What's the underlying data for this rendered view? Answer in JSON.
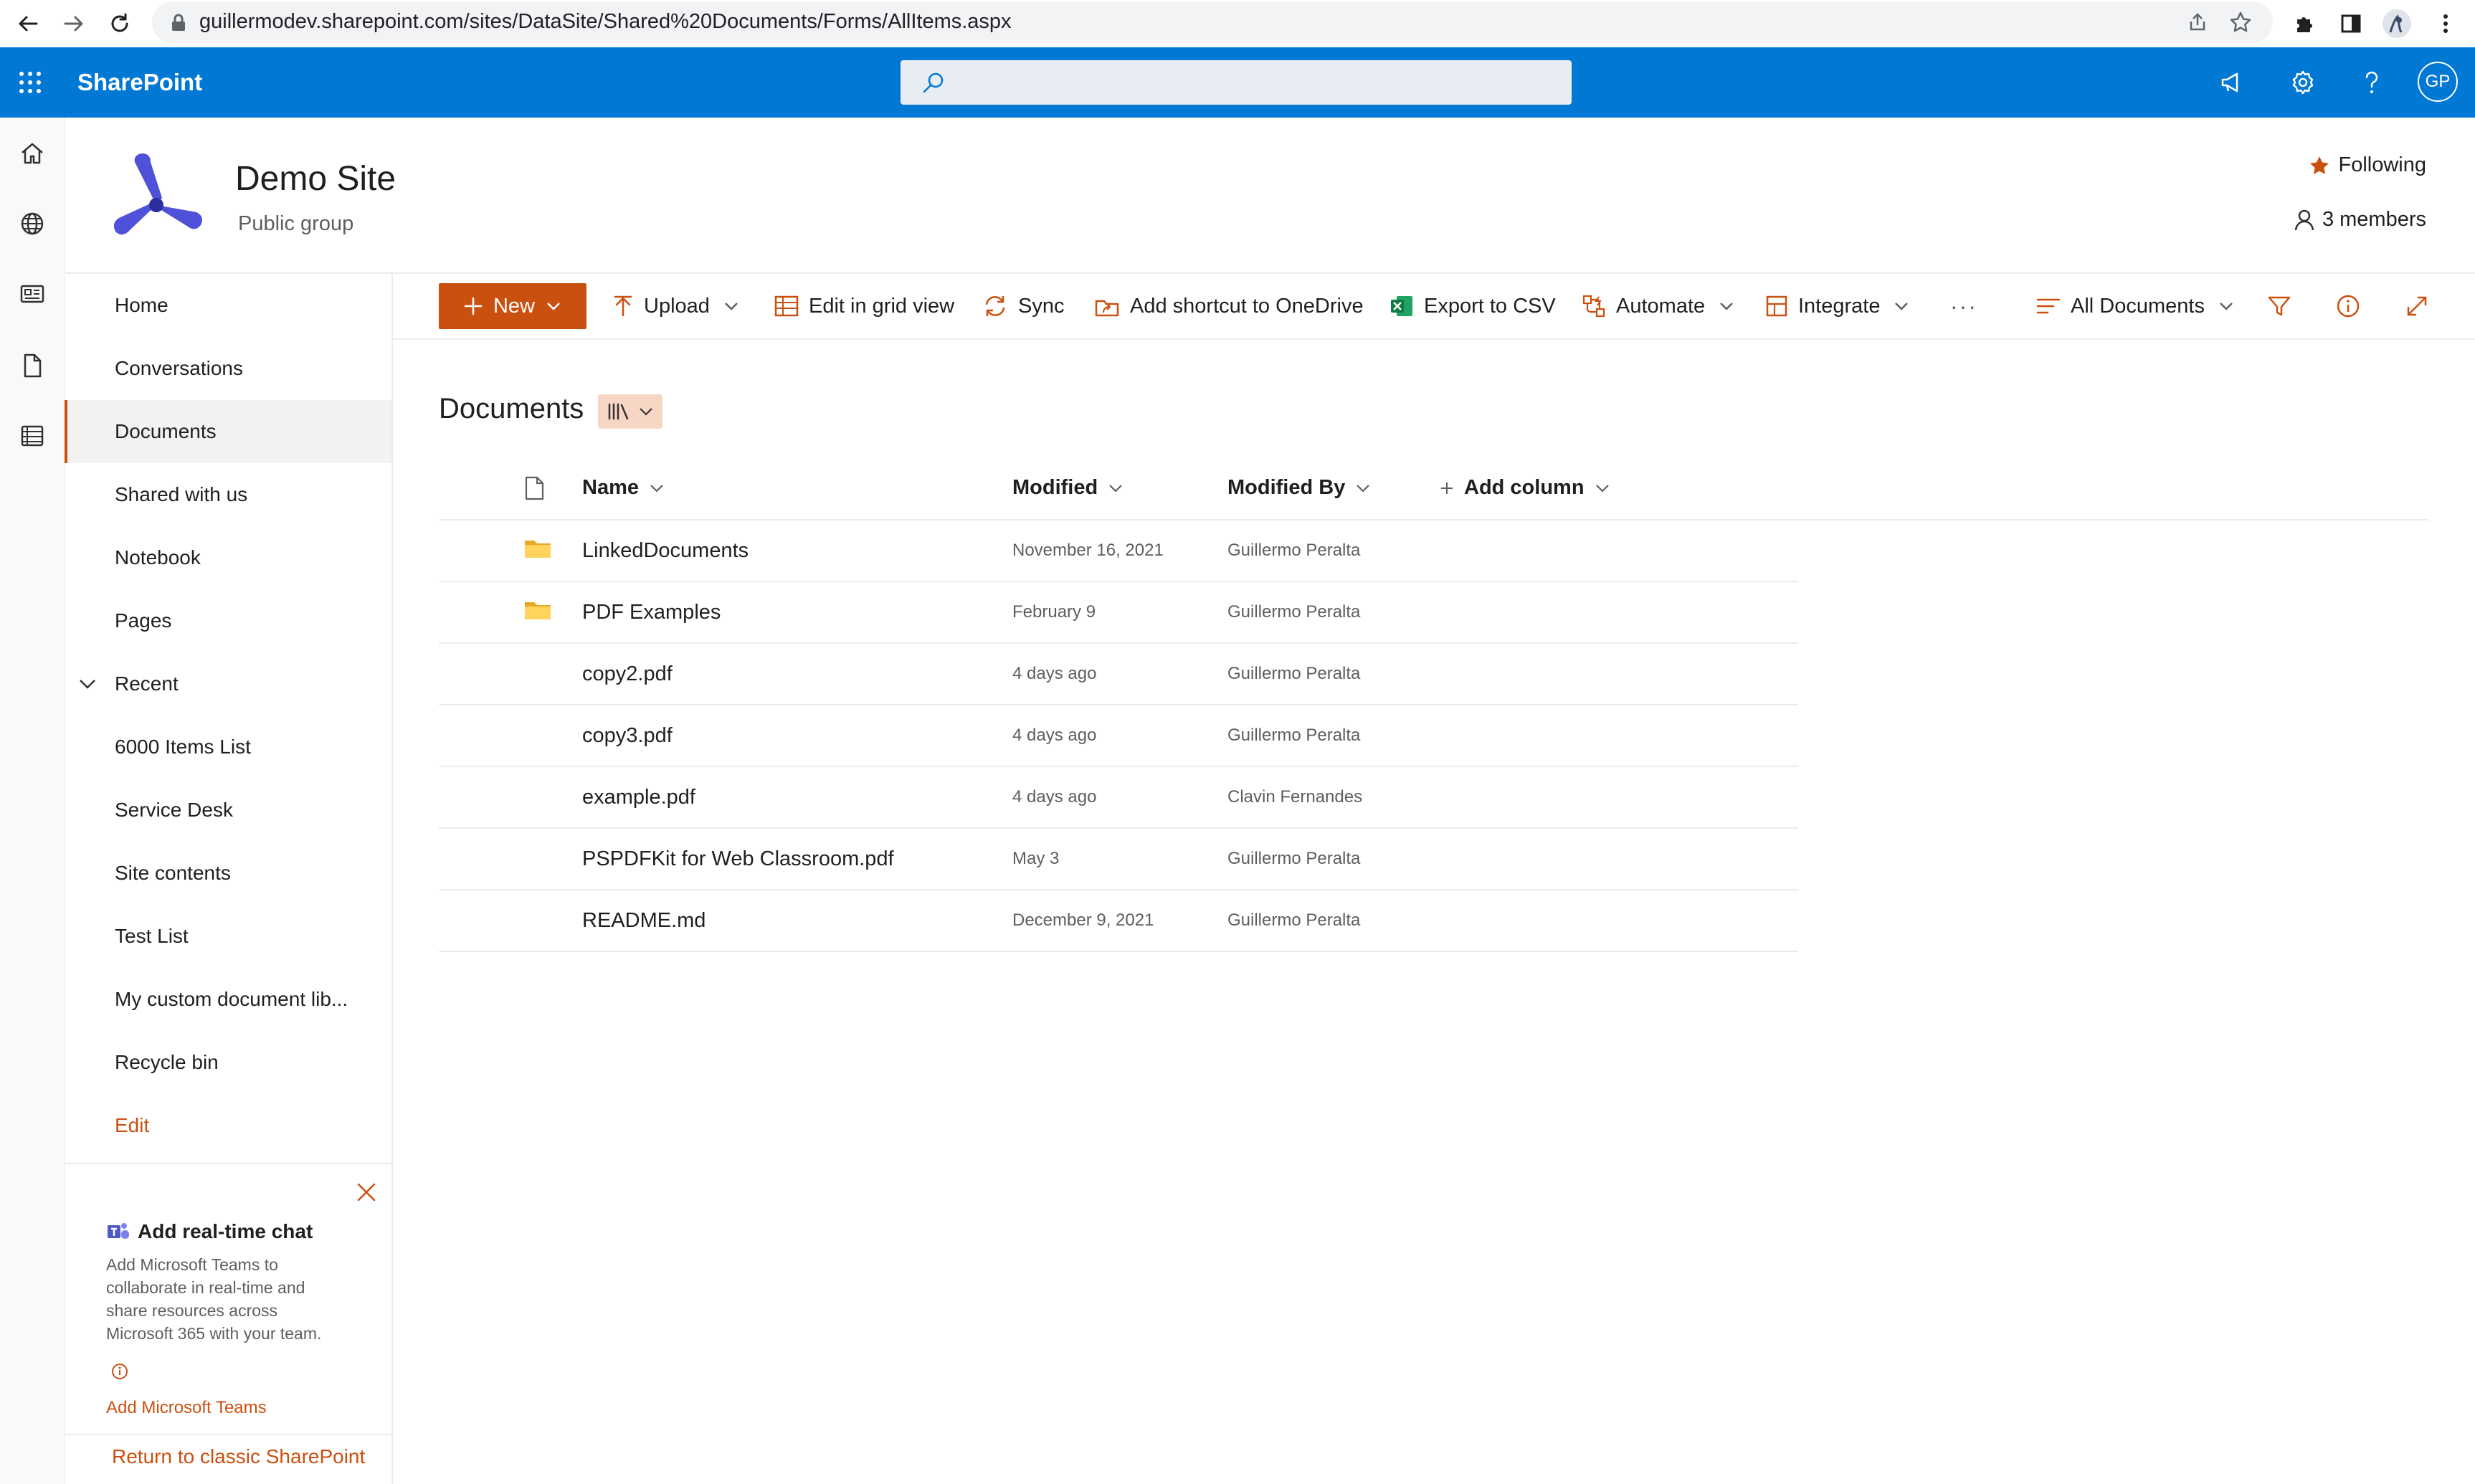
{
  "browser": {
    "url": "guillermodev.sharepoint.com/sites/DataSite/Shared%20Documents/Forms/AllItems.aspx"
  },
  "suite": {
    "app_name": "SharePoint",
    "avatar_initials": "GP"
  },
  "site": {
    "title": "Demo Site",
    "subtitle": "Public group",
    "following_label": "Following",
    "members_label": "3 members"
  },
  "nav": {
    "items": [
      {
        "label": "Home"
      },
      {
        "label": "Conversations"
      },
      {
        "label": "Documents"
      },
      {
        "label": "Shared with us"
      },
      {
        "label": "Notebook"
      },
      {
        "label": "Pages"
      },
      {
        "label": "Recent"
      },
      {
        "label": "6000 Items List"
      },
      {
        "label": "Service Desk"
      },
      {
        "label": "Site contents"
      },
      {
        "label": "Test List"
      },
      {
        "label": "My custom document lib..."
      },
      {
        "label": "Recycle bin"
      },
      {
        "label": "Edit"
      }
    ],
    "selected": "Documents",
    "teams_card": {
      "title": "Add real-time chat",
      "description": "Add Microsoft Teams to collaborate in real-time and share resources across Microsoft 365 with your team.",
      "link": "Add Microsoft Teams"
    },
    "classic_link": "Return to classic SharePoint"
  },
  "commands": {
    "new": "New",
    "upload": "Upload",
    "grid": "Edit in grid view",
    "sync": "Sync",
    "shortcut": "Add shortcut to OneDrive",
    "export": "Export to CSV",
    "automate": "Automate",
    "integrate": "Integrate",
    "more": "···",
    "view": "All Documents"
  },
  "library": {
    "title": "Documents",
    "columns": {
      "name": "Name",
      "modified": "Modified",
      "modified_by": "Modified By",
      "add_column": "Add column"
    },
    "rows": [
      {
        "name": "LinkedDocuments",
        "modified": "November 16, 2021",
        "modified_by": "Guillermo Peralta",
        "type": "folder"
      },
      {
        "name": "PDF Examples",
        "modified": "February 9",
        "modified_by": "Guillermo Peralta",
        "type": "folder"
      },
      {
        "name": "copy2.pdf",
        "modified": "4 days ago",
        "modified_by": "Guillermo Peralta",
        "type": "file"
      },
      {
        "name": "copy3.pdf",
        "modified": "4 days ago",
        "modified_by": "Guillermo Peralta",
        "type": "file"
      },
      {
        "name": "example.pdf",
        "modified": "4 days ago",
        "modified_by": "Clavin Fernandes",
        "type": "file"
      },
      {
        "name": "PSPDFKit for Web Classroom.pdf",
        "modified": "May 3",
        "modified_by": "Guillermo Peralta",
        "type": "file"
      },
      {
        "name": "README.md",
        "modified": "December 9, 2021",
        "modified_by": "Guillermo Peralta",
        "type": "file"
      }
    ]
  },
  "colors": {
    "suite_blue": "#0078d4",
    "accent_orange": "#ca5010",
    "folder_yellow": "#ffd35c"
  }
}
